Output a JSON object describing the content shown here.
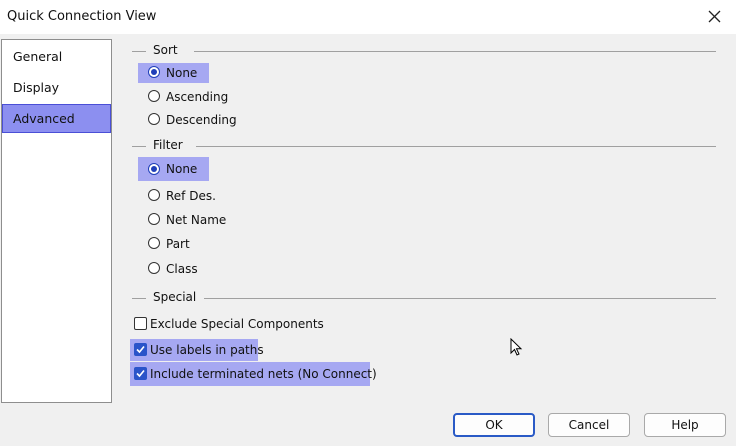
{
  "window": {
    "title": "Quick Connection View"
  },
  "nav": {
    "items": [
      {
        "label": "General",
        "selected": false
      },
      {
        "label": "Display",
        "selected": false
      },
      {
        "label": "Advanced",
        "selected": true
      }
    ]
  },
  "sort": {
    "title": "Sort",
    "options": [
      {
        "label": "None",
        "selected": true
      },
      {
        "label": "Ascending",
        "selected": false
      },
      {
        "label": "Descending",
        "selected": false
      }
    ]
  },
  "filter": {
    "title": "Filter",
    "options": [
      {
        "label": "None",
        "selected": true
      },
      {
        "label": "Ref Des.",
        "selected": false
      },
      {
        "label": "Net Name",
        "selected": false
      },
      {
        "label": "Part",
        "selected": false
      },
      {
        "label": "Class",
        "selected": false
      }
    ]
  },
  "special": {
    "title": "Special",
    "options": [
      {
        "label": "Exclude Special Components",
        "checked": false
      },
      {
        "label": "Use labels in paths",
        "checked": true
      },
      {
        "label": "Include terminated nets (No Connect)",
        "checked": true
      }
    ]
  },
  "buttons": {
    "ok": "OK",
    "cancel": "Cancel",
    "help": "Help"
  },
  "colors": {
    "highlight": "#a6a8f2",
    "selected_nav": "#8c8ff0",
    "accent": "#2a54c9"
  }
}
